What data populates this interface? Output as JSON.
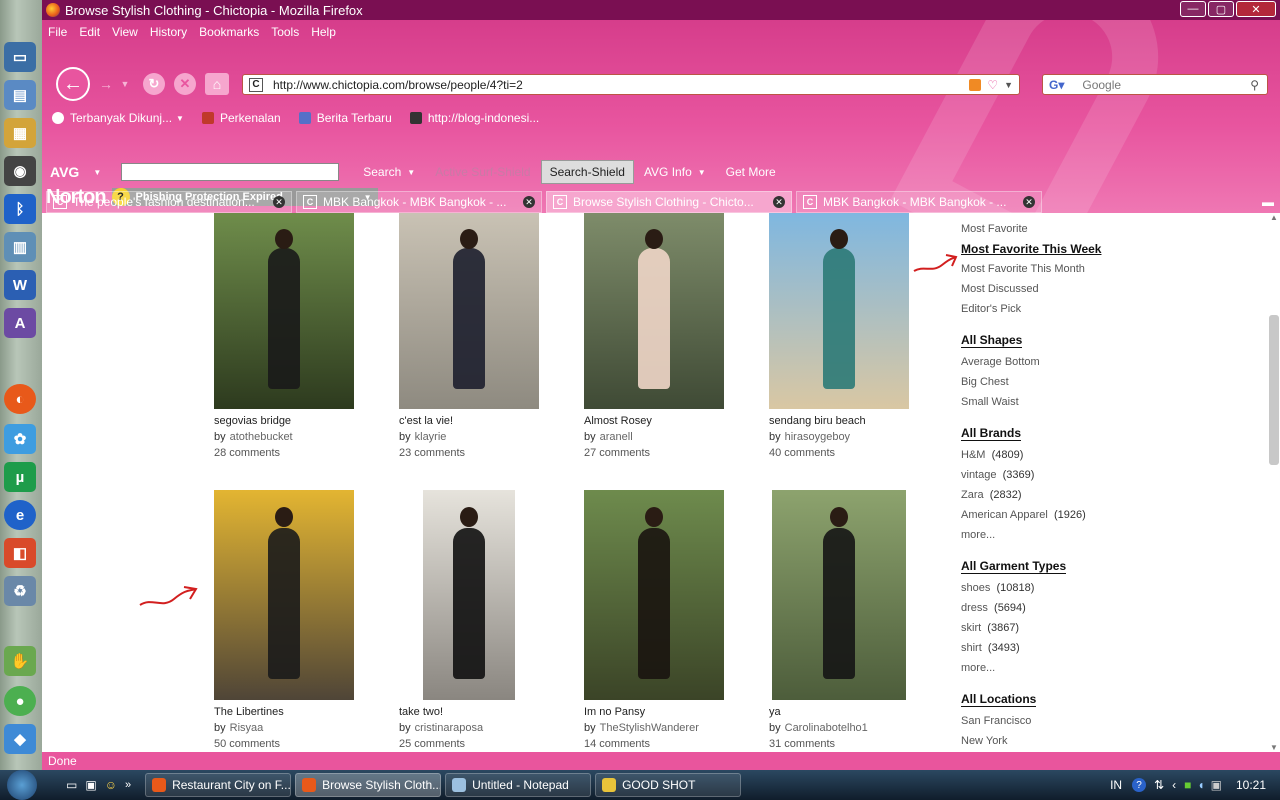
{
  "window": {
    "title": "Browse Stylish Clothing - Chictopia - Mozilla Firefox"
  },
  "menu": [
    "File",
    "Edit",
    "View",
    "History",
    "Bookmarks",
    "Tools",
    "Help"
  ],
  "url": "http://www.chictopia.com/browse/people/4?ti=2",
  "search_placeholder": "Google",
  "bookmarks": [
    {
      "label": "Terbanyak Dikunj...",
      "color": "#ffffff"
    },
    {
      "label": "Perkenalan",
      "color": "#c0392b"
    },
    {
      "label": "Berita Terbaru",
      "color": "#5570c8"
    },
    {
      "label": "http://blog-indonesi...",
      "color": "#333333"
    }
  ],
  "avg": {
    "logo": "AVG",
    "search": "Search",
    "active_surf": "Active Surf-Shield",
    "search_shield": "Search-Shield",
    "info": "AVG Info",
    "get_more": "Get More"
  },
  "norton": {
    "logo": "Norton",
    "phishing": "Phishing Protection Expired"
  },
  "tabs": [
    {
      "label": "The people's fashion destination...",
      "active": false
    },
    {
      "label": "MBK Bangkok - MBK Bangkok - ...",
      "active": false
    },
    {
      "label": "Browse Stylish Clothing - Chicto...",
      "active": true
    },
    {
      "label": "MBK Bangkok - MBK Bangkok - ...",
      "active": false
    }
  ],
  "cards": [
    {
      "title": "segovias bridge",
      "by": "by",
      "author": "atothebucket",
      "comments": "28 comments",
      "bg": [
        "#6f8d4b",
        "#2d3a1e"
      ],
      "coat": "#1a1a1a"
    },
    {
      "title": "c'est la vie!",
      "by": "by",
      "author": "klayrie",
      "comments": "23 comments",
      "bg": [
        "#c9c2b4",
        "#8e8a80"
      ],
      "coat": "#1d1f2e"
    },
    {
      "title": "Almost Rosey",
      "by": "by",
      "author": "aranell",
      "comments": "27 comments",
      "bg": [
        "#7e8c6a",
        "#3f4a35"
      ],
      "coat": "#f0d6c8"
    },
    {
      "title": "sendang biru beach",
      "by": "by",
      "author": "hirasoygeboy",
      "comments": "40 comments",
      "bg": [
        "#7fb7e0",
        "#d9c7a3"
      ],
      "coat": "#2c7a77"
    },
    {
      "title": "The Libertines",
      "by": "by",
      "author": "Risyaa",
      "comments": "50 comments",
      "bg": [
        "#e3b532",
        "#4f4537"
      ],
      "coat": "#1b1b1b"
    },
    {
      "title": "take two!",
      "by": "by",
      "author": "cristinaraposa",
      "comments": "25 comments",
      "bg": [
        "#e6e3dc",
        "#8a8680"
      ],
      "coat": "#111111"
    },
    {
      "title": "Im no Pansy",
      "by": "by",
      "author": "TheStylishWanderer",
      "comments": "14 comments",
      "bg": [
        "#6e8b4d",
        "#3b4427"
      ],
      "coat": "#1a1410"
    },
    {
      "title": "ya",
      "by": "by",
      "author": "Carolinabotelho1",
      "comments": "31 comments",
      "bg": [
        "#8da36e",
        "#4d5d3b"
      ],
      "coat": "#151515"
    }
  ],
  "sidebar": {
    "sort": [
      "Most Favorite",
      "Most Favorite This Week",
      "Most Favorite This Month",
      "Most Discussed",
      "Editor's Pick"
    ],
    "shapes_header": "All Shapes",
    "shapes": [
      "Average Bottom",
      "Big Chest",
      "Small Waist"
    ],
    "brands_header": "All Brands",
    "brands": [
      {
        "name": "H&M",
        "count": "(4809)"
      },
      {
        "name": "vintage",
        "count": "(3369)"
      },
      {
        "name": "Zara",
        "count": "(2832)"
      },
      {
        "name": "American Apparel",
        "count": "(1926)"
      }
    ],
    "brands_more": "more...",
    "garments_header": "All Garment Types",
    "garments": [
      {
        "name": "shoes",
        "count": "(10818)"
      },
      {
        "name": "dress",
        "count": "(5694)"
      },
      {
        "name": "skirt",
        "count": "(3867)"
      },
      {
        "name": "shirt",
        "count": "(3493)"
      }
    ],
    "garments_more": "more...",
    "locations_header": "All Locations",
    "locations": [
      "San Francisco",
      "New York"
    ]
  },
  "status": "Done",
  "taskbar": [
    {
      "label": "Restaurant City on F...",
      "color": "#e8591a"
    },
    {
      "label": "Browse Stylish Cloth...",
      "color": "#e8591a",
      "active": true
    },
    {
      "label": "Untitled - Notepad",
      "color": "#9cc0e0"
    },
    {
      "label": "GOOD SHOT",
      "color": "#e8c33a"
    }
  ],
  "tray": {
    "lang": "IN",
    "time": "10:21"
  }
}
